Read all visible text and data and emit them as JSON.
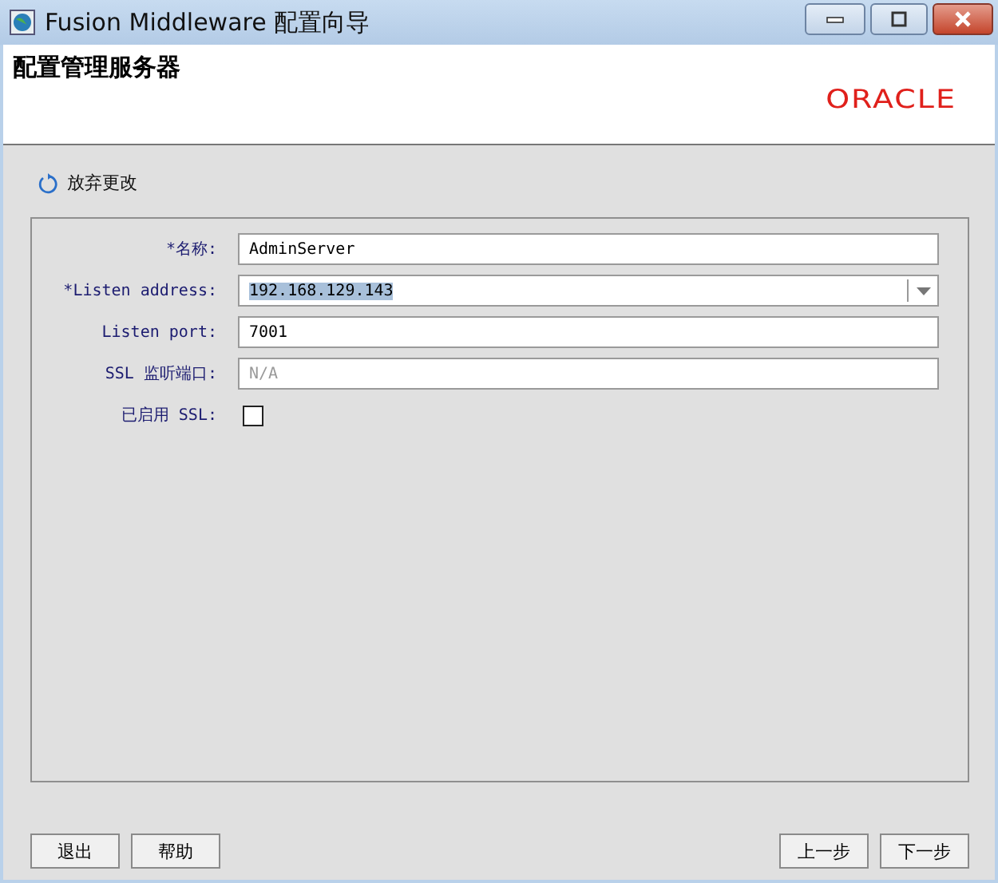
{
  "window": {
    "title": "Fusion Middleware 配置向导"
  },
  "header": {
    "title": "配置管理服务器",
    "logo": "ORACLE"
  },
  "discard_link": "放弃更改",
  "fields": [
    {
      "kind": "text",
      "label": "*名称:",
      "value": "AdminServer"
    },
    {
      "kind": "combo",
      "label": "*Listen address:",
      "value": "192.168.129.143"
    },
    {
      "kind": "text",
      "label": "Listen port:",
      "value": "7001"
    },
    {
      "kind": "text",
      "label": "SSL 监听端口:",
      "placeholder": "N/A"
    },
    {
      "kind": "checkbox",
      "label": "已启用 SSL:",
      "checked": false
    }
  ],
  "buttons_left": [
    "退出",
    "帮助"
  ],
  "buttons_right": [
    "上一步",
    "下一步"
  ]
}
